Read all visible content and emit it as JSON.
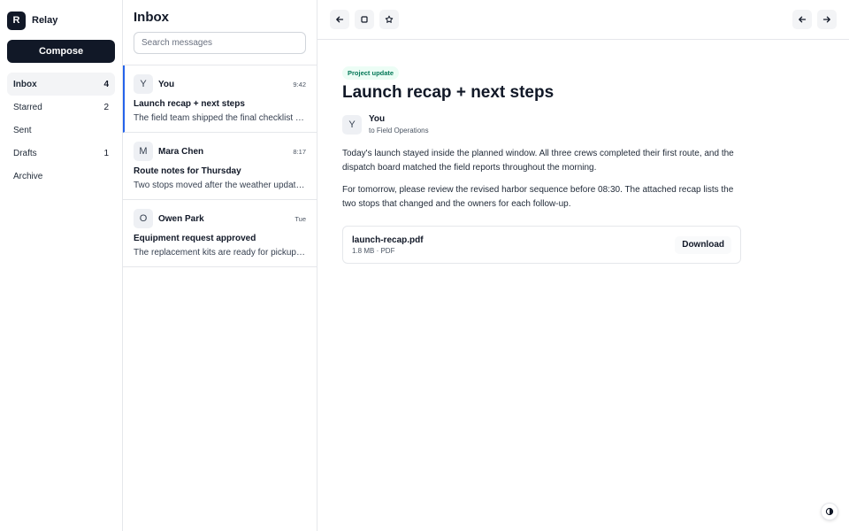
{
  "app": {
    "logo_letter": "R",
    "name": "Relay"
  },
  "sidebar": {
    "compose_label": "Compose",
    "items": [
      {
        "label": "Inbox",
        "count": "4"
      },
      {
        "label": "Starred",
        "count": "2"
      },
      {
        "label": "Sent",
        "count": ""
      },
      {
        "label": "Drafts",
        "count": "1"
      },
      {
        "label": "Archive",
        "count": ""
      }
    ]
  },
  "list": {
    "title": "Inbox",
    "search_placeholder": "Search messages",
    "messages": [
      {
        "avatar": "Y",
        "sender": "You",
        "time": "9:42",
        "subject": "Launch recap + next steps",
        "preview": "The field team shipped the final checklist and confirmed"
      },
      {
        "avatar": "M",
        "sender": "Mara Chen",
        "time": "8:17",
        "subject": "Route notes for Thursday",
        "preview": "Two stops moved after the weather update this morning"
      },
      {
        "avatar": "O",
        "sender": "Owen Park",
        "time": "Tue",
        "subject": "Equipment request approved",
        "preview": "The replacement kits are ready for pickup at the depot"
      }
    ]
  },
  "reader": {
    "tag": "Project update",
    "subject": "Launch recap + next steps",
    "from": {
      "avatar": "Y",
      "name": "You",
      "to": "to Field Operations"
    },
    "paragraphs": [
      "Today's launch stayed inside the planned window. All three crews completed their first route, and the dispatch board matched the field reports throughout the morning.",
      "For tomorrow, please review the revised harbor sequence before 08:30. The attached recap lists the two stops that changed and the owners for each follow-up."
    ],
    "attachment": {
      "name": "launch-recap.pdf",
      "meta": "1.8 MB · PDF",
      "action": "Download"
    }
  },
  "icons": {
    "back": "arrow-left-icon",
    "archive": "square-icon",
    "star": "star-icon",
    "prev": "arrow-left-icon",
    "next": "arrow-right-icon",
    "theme": "contrast-icon"
  },
  "colors": {
    "accent": "#2563eb",
    "primary": "#111827",
    "tag_bg": "#ecfdf5",
    "tag_text": "#047857"
  }
}
